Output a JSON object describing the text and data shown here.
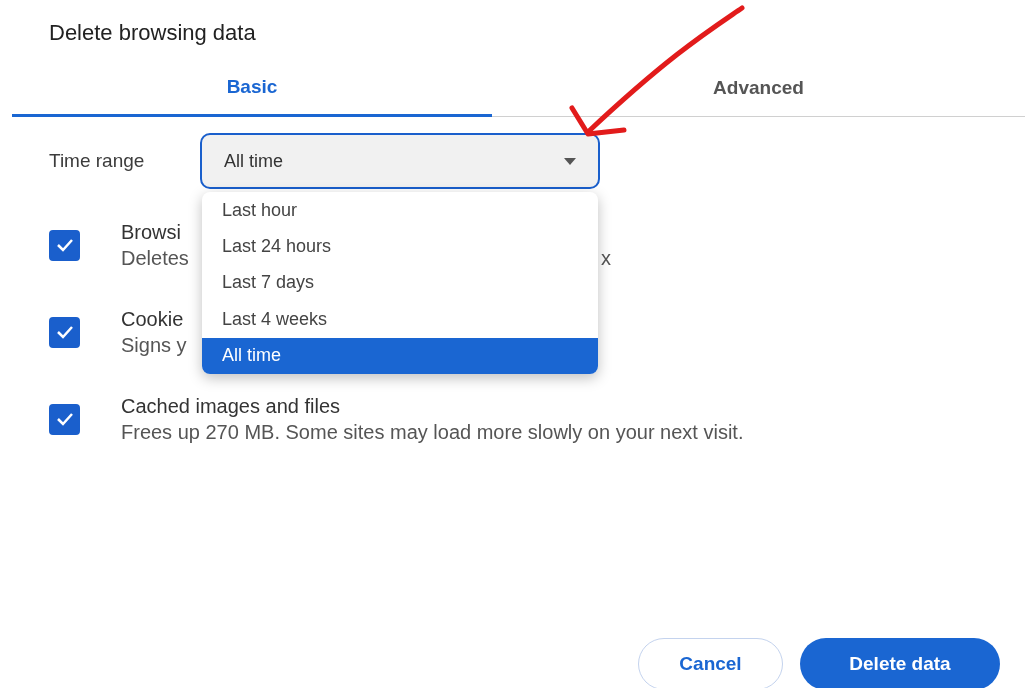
{
  "dialog": {
    "title": "Delete browsing data"
  },
  "tabs": [
    {
      "label": "Basic",
      "selected": true
    },
    {
      "label": "Advanced",
      "selected": false
    }
  ],
  "time_range": {
    "label": "Time range",
    "value": "All time",
    "expanded": true,
    "options": [
      {
        "label": "Last hour",
        "selected": false
      },
      {
        "label": "Last 24 hours",
        "selected": false
      },
      {
        "label": "Last 7 days",
        "selected": false
      },
      {
        "label": "Last 4 weeks",
        "selected": false
      },
      {
        "label": "All time",
        "selected": true
      }
    ]
  },
  "items": [
    {
      "title": "Browsi",
      "description": "Deletes",
      "description_end": "x",
      "checked": true
    },
    {
      "title": "Cookie",
      "description": "Signs y",
      "checked": true
    },
    {
      "title": "Cached images and files",
      "description": "Frees up 270 MB. Some sites may load more slowly on your next visit.",
      "checked": true
    }
  ],
  "buttons": [
    {
      "label": "Cancel",
      "kind": "secondary"
    },
    {
      "label": "Delete data",
      "kind": "primary"
    }
  ]
}
